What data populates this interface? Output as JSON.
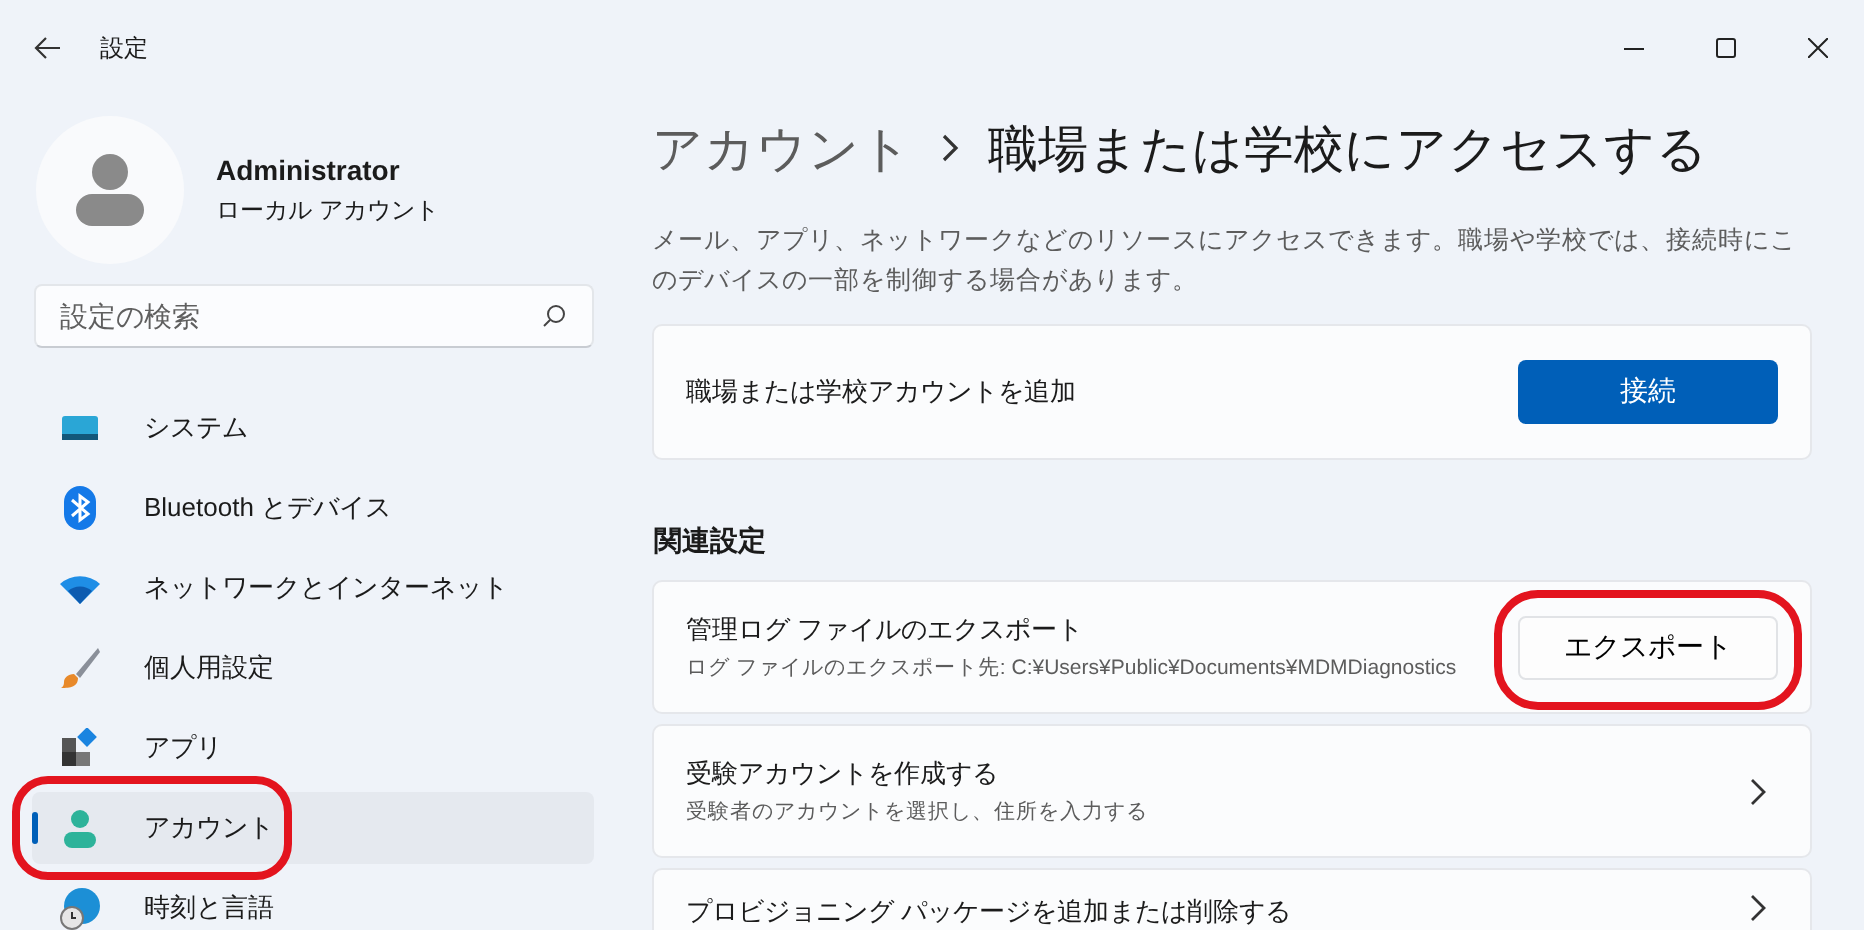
{
  "window": {
    "title": "設定"
  },
  "profile": {
    "name": "Administrator",
    "account_type": "ローカル アカウント"
  },
  "search": {
    "placeholder": "設定の検索"
  },
  "nav": [
    {
      "label": "システム",
      "kind": "system",
      "selected": false,
      "highlighted": false
    },
    {
      "label": "Bluetooth とデバイス",
      "kind": "bluetooth",
      "selected": false,
      "highlighted": false
    },
    {
      "label": "ネットワークとインターネット",
      "kind": "network",
      "selected": false,
      "highlighted": false
    },
    {
      "label": "個人用設定",
      "kind": "personalize",
      "selected": false,
      "highlighted": false
    },
    {
      "label": "アプリ",
      "kind": "apps",
      "selected": false,
      "highlighted": false
    },
    {
      "label": "アカウント",
      "kind": "accounts",
      "selected": true,
      "highlighted": true
    },
    {
      "label": "時刻と言語",
      "kind": "time",
      "selected": false,
      "highlighted": false
    }
  ],
  "breadcrumb": [
    "アカウント",
    "職場または学校にアクセスする"
  ],
  "description": "メール、アプリ、ネットワークなどのリソースにアクセスできます。職場や学校では、接続時にこのデバイスの一部を制御する場合があります。",
  "add_card": {
    "label": "職場または学校アカウントを追加",
    "button": "接続"
  },
  "related": {
    "heading": "関連設定",
    "items": [
      {
        "kind": "button",
        "title": "管理ログ ファイルのエクスポート",
        "subtitle": "ログ ファイルのエクスポート先: C:¥Users¥Public¥Documents¥MDMDiagnostics",
        "button": "エクスポート",
        "highlighted": true
      },
      {
        "kind": "link",
        "title": "受験アカウントを作成する",
        "subtitle": "受験者のアカウントを選択し、住所を入力する",
        "highlighted": false
      },
      {
        "kind": "link",
        "title": "プロビジョニング パッケージを追加または削除する",
        "highlighted": false
      }
    ]
  }
}
